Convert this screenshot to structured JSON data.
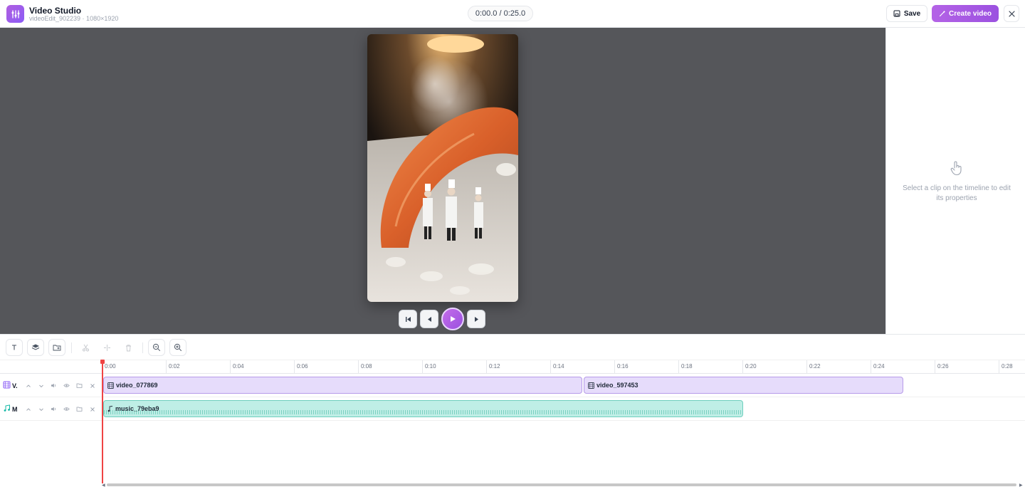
{
  "header": {
    "app_title": "Video Studio",
    "app_subtitle": "videoEdit_902239 · 1080×1920",
    "time_display": "0:00.0 / 0:25.0",
    "save_label": "Save",
    "create_label": "Create video"
  },
  "right_panel": {
    "hint": "Select a clip on the timeline to edit its properties"
  },
  "ruler": {
    "ticks": [
      "0:00",
      "0:02",
      "0:04",
      "0:06",
      "0:08",
      "0:10",
      "0:12",
      "0:14",
      "0:16",
      "0:18",
      "0:20",
      "0:22",
      "0:24",
      "0:26",
      "0:28"
    ]
  },
  "tracks": [
    {
      "short_name": "V.",
      "type": "video",
      "clips": [
        {
          "label": "video_077869"
        },
        {
          "label": "video_597453"
        }
      ]
    },
    {
      "short_name": "M",
      "type": "music",
      "clips": [
        {
          "label": "music_79eba9"
        }
      ]
    }
  ],
  "colors": {
    "accent": "#9b51e0",
    "playhead": "#ef4444",
    "video_clip": "#e6dcfb",
    "music_clip": "#bfeee6"
  }
}
